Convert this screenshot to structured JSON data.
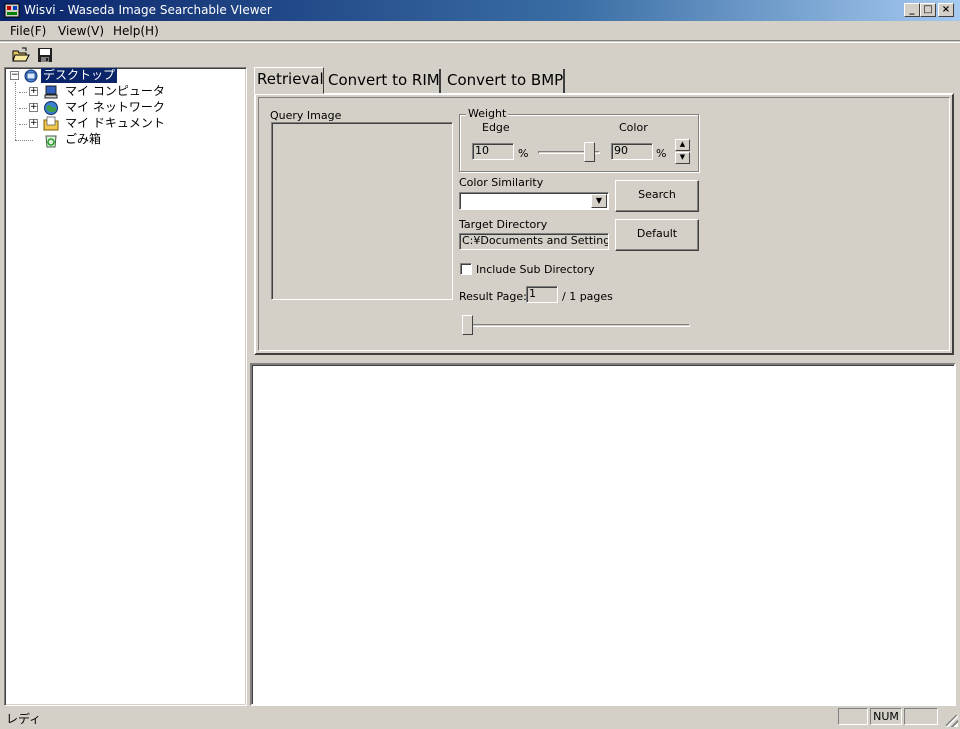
{
  "window": {
    "title": "Wisvi - Waseda Image Searchable VIewer",
    "controls": {
      "minimize": "_",
      "maximize": "□",
      "close": "×"
    }
  },
  "menu": {
    "items": [
      "File(F)",
      "View(V)",
      "Help(H)"
    ]
  },
  "toolbar": {
    "tools": [
      {
        "icon": "open-folder-icon"
      },
      {
        "icon": "save-disk-icon"
      }
    ]
  },
  "tree": {
    "root": {
      "label": "デスクトップ",
      "icon": "desktop-icon",
      "expander": "−"
    },
    "children": [
      {
        "label": "マイ コンピュータ",
        "icon": "computer-icon",
        "expander": "+"
      },
      {
        "label": "マイ ネットワーク",
        "icon": "network-icon",
        "expander": "+"
      },
      {
        "label": "マイ ドキュメント",
        "icon": "documents-folder-icon",
        "expander": "+"
      },
      {
        "label": "ごみ箱",
        "icon": "recycle-bin-icon",
        "expander": ""
      }
    ]
  },
  "tabs": [
    {
      "label": "Retrieval",
      "active": true
    },
    {
      "label": "Convert to RIM",
      "active": false
    },
    {
      "label": "Convert to BMP",
      "active": false
    }
  ],
  "retrieval": {
    "query_image_label": "Query Image",
    "weight": {
      "title": "Weight",
      "edge_label": "Edge",
      "color_label": "Color",
      "edge_value": "10",
      "color_value": "90",
      "percent": "%",
      "slider_fraction": 0.9
    },
    "color_similarity_label": "Color Similarity",
    "color_similarity_value": "",
    "search_button": "Search",
    "target_directory_label": "Target Directory",
    "target_directory_value": "C:¥Documents and Settings¥",
    "default_button": "Default",
    "include_sub_label": "Include Sub Directory",
    "include_sub_checked": false,
    "result_page_label": "Result Page:",
    "result_page_value": "1",
    "pages_text": "/ 1 pages",
    "page_slider_fraction": 0.0
  },
  "statusbar": {
    "text": "レディ",
    "panes": [
      "",
      "NUM",
      ""
    ]
  }
}
